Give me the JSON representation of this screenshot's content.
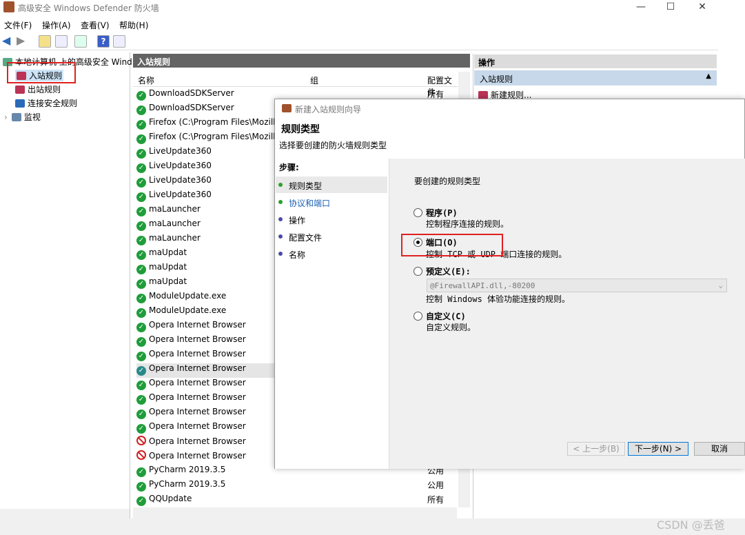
{
  "window": {
    "title": "高级安全 Windows Defender 防火墙",
    "minimize": "—",
    "maximize": "☐",
    "close": "✕"
  },
  "menu": [
    "文件(F)",
    "操作(A)",
    "查看(V)",
    "帮助(H)"
  ],
  "tree": {
    "root": "本地计算机 上的高级安全 Wind",
    "items": [
      "入站规则",
      "出站规则",
      "连接安全规则",
      "监视"
    ],
    "expander": "›"
  },
  "main": {
    "header": "入站规则",
    "columns": [
      "名称",
      "组",
      "配置文件"
    ],
    "rows": [
      {
        "name": "DownloadSDKServer",
        "profile": "所有",
        "status": "ok"
      },
      {
        "name": "DownloadSDKServer",
        "profile": "",
        "status": "ok"
      },
      {
        "name": "Firefox (C:\\Program Files\\Mozill",
        "profile": "",
        "status": "ok"
      },
      {
        "name": "Firefox (C:\\Program Files\\Mozill",
        "profile": "",
        "status": "ok"
      },
      {
        "name": "LiveUpdate360",
        "profile": "",
        "status": "ok"
      },
      {
        "name": "LiveUpdate360",
        "profile": "",
        "status": "ok"
      },
      {
        "name": "LiveUpdate360",
        "profile": "",
        "status": "ok"
      },
      {
        "name": "LiveUpdate360",
        "profile": "",
        "status": "ok"
      },
      {
        "name": "maLauncher",
        "profile": "",
        "status": "ok"
      },
      {
        "name": "maLauncher",
        "profile": "",
        "status": "ok"
      },
      {
        "name": "maLauncher",
        "profile": "",
        "status": "ok"
      },
      {
        "name": "maUpdat",
        "profile": "",
        "status": "ok"
      },
      {
        "name": "maUpdat",
        "profile": "",
        "status": "ok"
      },
      {
        "name": "maUpdat",
        "profile": "",
        "status": "ok"
      },
      {
        "name": "ModuleUpdate.exe",
        "profile": "",
        "status": "ok"
      },
      {
        "name": "ModuleUpdate.exe",
        "profile": "",
        "status": "ok"
      },
      {
        "name": "Opera Internet Browser",
        "profile": "",
        "status": "ok"
      },
      {
        "name": "Opera Internet Browser",
        "profile": "",
        "status": "ok"
      },
      {
        "name": "Opera Internet Browser",
        "profile": "",
        "status": "ok"
      },
      {
        "name": "Opera Internet Browser",
        "profile": "",
        "status": "ok"
      },
      {
        "name": "Opera Internet Browser",
        "profile": "",
        "status": "ok"
      },
      {
        "name": "Opera Internet Browser",
        "profile": "",
        "status": "ok"
      },
      {
        "name": "Opera Internet Browser",
        "profile": "",
        "status": "ok"
      },
      {
        "name": "Opera Internet Browser",
        "profile": "",
        "status": "ok"
      },
      {
        "name": "Opera Internet Browser",
        "profile": "",
        "status": "block"
      },
      {
        "name": "Opera Internet Browser",
        "profile": "",
        "status": "block"
      },
      {
        "name": "PyCharm 2019.3.5",
        "profile": "公用",
        "status": "ok"
      },
      {
        "name": "PyCharm 2019.3.5",
        "profile": "公用",
        "status": "ok"
      },
      {
        "name": "QQUpdate",
        "profile": "所有",
        "status": "ok"
      }
    ]
  },
  "actions": {
    "header": "操作",
    "section": "入站规则",
    "item": "新建规则..."
  },
  "wizard": {
    "title": "新建入站规则向导",
    "heading": "规则类型",
    "subheading": "选择要创建的防火墙规则类型",
    "steps_label": "步骤:",
    "steps": [
      "规则类型",
      "协议和端口",
      "操作",
      "配置文件",
      "名称"
    ],
    "question": "要创建的规则类型",
    "options": [
      {
        "label": "程序(P)",
        "desc": "控制程序连接的规则。",
        "selected": false
      },
      {
        "label": "端口(O)",
        "desc": "控制 TCP 或 UDP 端口连接的规则。",
        "selected": true
      },
      {
        "label": "预定义(E):",
        "desc": "控制 Windows 体验功能连接的规则。",
        "selected": false
      },
      {
        "label": "自定义(C)",
        "desc": "自定义规则。",
        "selected": false
      }
    ],
    "predefined_value": "@FirewallAPI.dll,-80200",
    "buttons": {
      "back": "< 上一步(B)",
      "next": "下一步(N) >",
      "cancel": "取消"
    }
  },
  "watermark": "CSDN @丢爸"
}
